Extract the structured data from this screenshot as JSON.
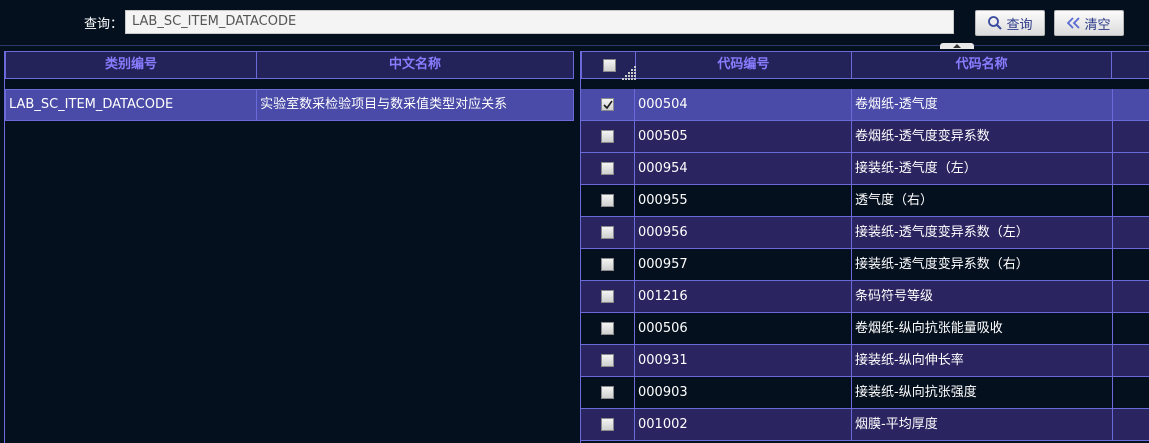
{
  "search": {
    "label": "查询：",
    "value": "LAB_SC_ITEM_DATACODE",
    "search_button": "查询",
    "clear_button": "清空"
  },
  "left_grid": {
    "columns": [
      "类别编号",
      "中文名称"
    ],
    "rows": [
      {
        "code": "LAB_SC_ITEM_DATACODE",
        "name": "实验室数采检验项目与数采值类型对应关系",
        "selected": true
      }
    ]
  },
  "right_grid": {
    "columns": [
      "",
      "代码编号",
      "代码名称",
      ""
    ],
    "rows": [
      {
        "checked": true,
        "code": "000504",
        "name": "卷烟纸-透气度"
      },
      {
        "checked": false,
        "code": "000505",
        "name": "卷烟纸-透气度变异系数"
      },
      {
        "checked": false,
        "code": "000954",
        "name": "接装纸-透气度（左）"
      },
      {
        "checked": false,
        "code": "000955",
        "name": "透气度（右）"
      },
      {
        "checked": false,
        "code": "000956",
        "name": "接装纸-透气度变异系数（左）"
      },
      {
        "checked": false,
        "code": "000957",
        "name": "接装纸-透气度变异系数（右）"
      },
      {
        "checked": false,
        "code": "001216",
        "name": "条码符号等级"
      },
      {
        "checked": false,
        "code": "000506",
        "name": "卷烟纸-纵向抗张能量吸收"
      },
      {
        "checked": false,
        "code": "000931",
        "name": "接装纸-纵向伸长率"
      },
      {
        "checked": false,
        "code": "000903",
        "name": "接装纸-纵向抗张强度"
      },
      {
        "checked": false,
        "code": "001002",
        "name": "烟膜-平均厚度"
      }
    ]
  },
  "icons": {
    "search_button_icon": "magnifier-icon",
    "clear_button_icon": "double-left-arrow-icon",
    "collapse_icon": "caret-up-icon"
  },
  "colors": {
    "background": "#05101f",
    "header_bg": "#232359",
    "header_text": "#8a7cff",
    "row_odd": "#2a2460",
    "row_selected": "#4a4aa8",
    "grid_line": "#6a6ad8"
  }
}
